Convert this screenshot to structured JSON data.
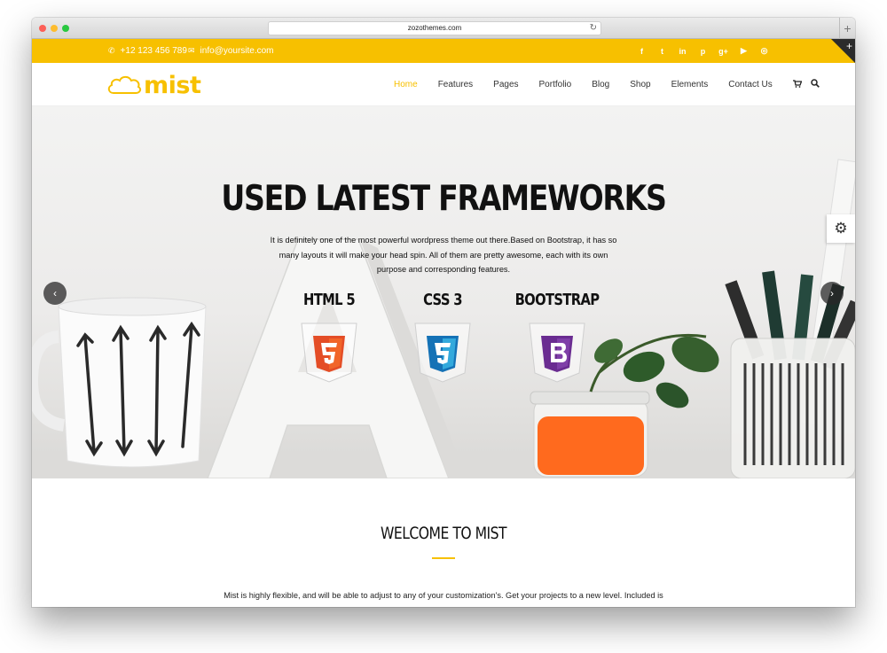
{
  "browser": {
    "url": "zozothemes.com",
    "reload_glyph": "↻",
    "newtab_glyph": "+"
  },
  "topbar": {
    "phone": "+12 123 456 789",
    "email": "info@yoursite.com",
    "phone_icon": "phone-icon",
    "email_icon": "envelope-icon",
    "socials": [
      "facebook-icon",
      "twitter-icon",
      "linkedin-icon",
      "pinterest-icon",
      "google-plus-icon",
      "youtube-icon",
      "dribbble-icon"
    ],
    "social_glyphs": [
      "f",
      "t",
      "in",
      "p",
      "g+",
      "▶",
      "◎"
    ],
    "accent_color": "#f7c000"
  },
  "header": {
    "logo_text": "mist",
    "nav": [
      "Home",
      "Features",
      "Pages",
      "Portfolio",
      "Blog",
      "Shop",
      "Elements",
      "Contact Us"
    ],
    "active_nav": "Home",
    "cart_icon": "cart-icon",
    "search_icon": "search-icon"
  },
  "hero": {
    "title": "USED LATEST FRAMEWORKS",
    "description": "It is definitely one of the most powerful wordpress theme out there.Based on Bootstrap, it has so many layouts it will make your head spin. All of them are pretty awesome, each with its own purpose and corresponding features.",
    "frameworks": [
      {
        "label": "HTML 5",
        "digit": "5",
        "color": "#e44d26"
      },
      {
        "label": "CSS 3",
        "digit": "3",
        "color": "#2a9fd8"
      },
      {
        "label": "BOOTSTRAP",
        "digit": "B",
        "color": "#6a2c91"
      }
    ],
    "prev_glyph": "‹",
    "next_glyph": "›",
    "settings_glyph": "⚙"
  },
  "welcome": {
    "title": "WELCOME TO MIST",
    "text": "Mist is highly flexible, and will be able to adjust to any of your customization's. Get your projects to a new level. Included is animation on view, Parallax block, counters and charts, high resolution graphics etc."
  }
}
